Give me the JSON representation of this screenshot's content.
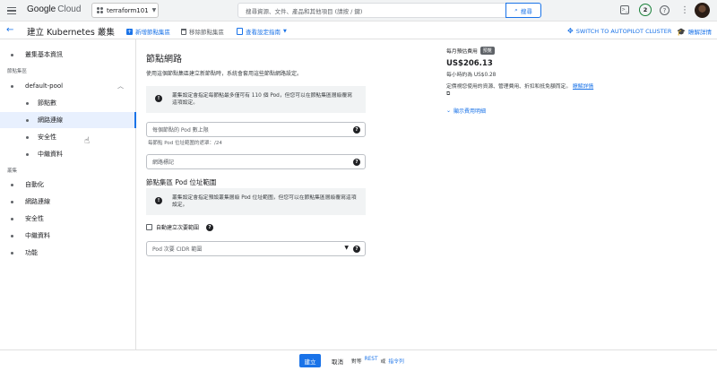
{
  "topbar": {
    "logo_google": "Google",
    "logo_cloud": "Cloud",
    "project": "terraform101",
    "search_placeholder": "搜尋資源、文件、產品和其他項目 (請按 / 鍵)",
    "search_button": "搜尋",
    "notification_count": "2"
  },
  "actionbar": {
    "title": "建立 Kubernetes 叢集",
    "add_pool": "新增節點集區",
    "remove_pool": "移除節點集區",
    "setup_guide": "查看設定指南",
    "switch_autopilot": "SWITCH TO AUTOPILOT CLUSTER",
    "learn": "瞭解詳情"
  },
  "sidebar": {
    "cluster_basics": "叢集基本資訊",
    "node_pools_label": "節點集區",
    "default_pool": "default-pool",
    "nodes": "節點數",
    "networking": "網路連線",
    "security": "安全性",
    "metadata": "中繼資料",
    "cluster_label": "叢集",
    "automation": "自動化",
    "cluster_networking": "網路連線",
    "cluster_security": "安全性",
    "cluster_metadata": "中繼資料",
    "features": "功能"
  },
  "main": {
    "title": "節點網路",
    "description": "使用這個節點集區建立新節點時，系統會套用這些節點網路設定。",
    "info1": "叢集設定會指定每節點最多僅可有 110 個 Pod，但您可以在節點集區層級覆寫這項設定。",
    "max_pods_placeholder": "每個節點的 Pod 數上限",
    "max_pods_hint": "每節點 Pod 位址範圍的遮罩：/24",
    "network_tags_placeholder": "網路標記",
    "pod_range_title": "節點集區 Pod 位址範圍",
    "info2": "叢集設定會指定預設叢集層級 Pod 位址範圍，但您可以在節點集區層級覆寫這項設定。",
    "auto_create_label": "自動建立次要範圍",
    "pod_cidr_placeholder": "Pod 次要 CIDR 範圍"
  },
  "cost": {
    "label": "每月預估費用",
    "badge": "預覽",
    "amount": "US$206.13",
    "hourly": "每小時約為 US$0.28",
    "note": "定價視您使用的資源、管理費用、折扣和抵免額而定。",
    "note_link": "瞭解詳情",
    "show_breakdown": "顯示費用明細"
  },
  "bottombar": {
    "create": "建立",
    "cancel": "取消",
    "equiv_prefix": "對等",
    "rest": "REST",
    "or": "或",
    "command_line": "指令列"
  },
  "colors": {
    "accent": "#1a73e8",
    "active_bg": "#e8f0fe"
  }
}
